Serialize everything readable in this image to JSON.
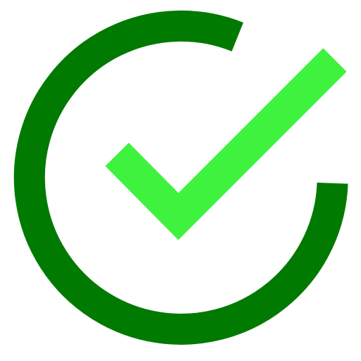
{
  "icon": {
    "name": "check-circle-icon",
    "circle_color": "#007a00",
    "check_color": "#3ef23e",
    "background": "#ffffff"
  }
}
